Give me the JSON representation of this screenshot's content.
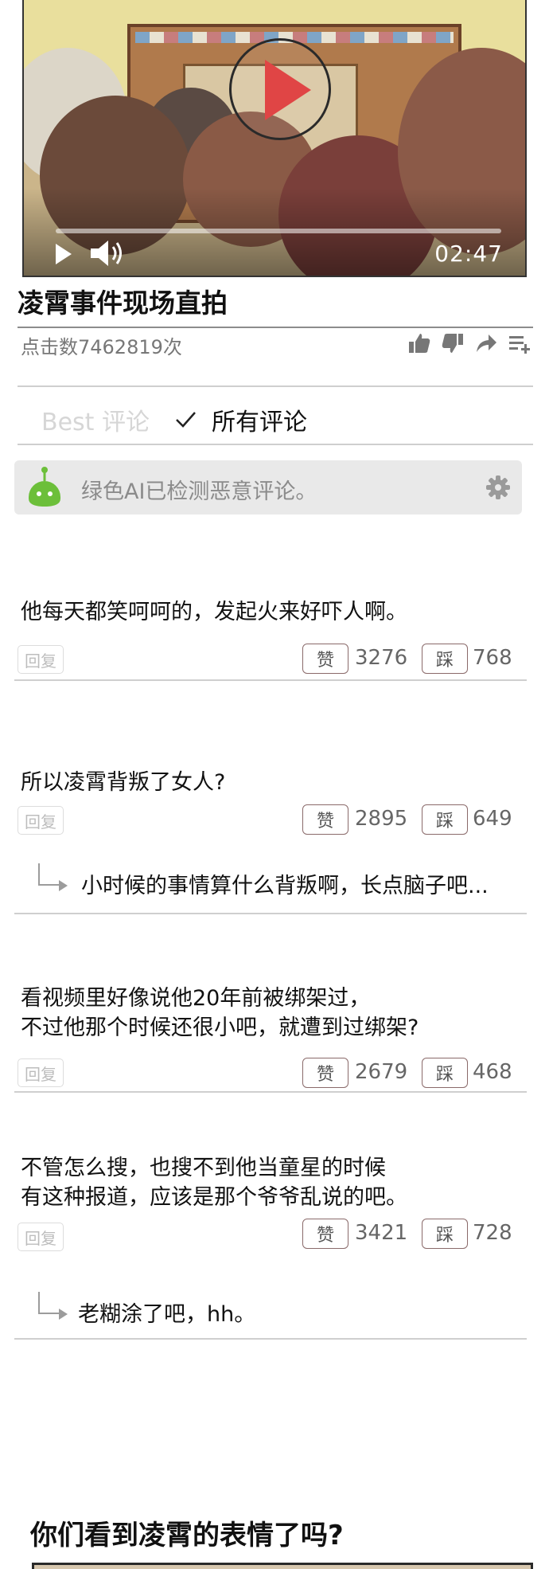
{
  "video": {
    "title": "凌霄事件现场直拍",
    "duration": "02:47",
    "progress": 0.0,
    "views": "点击数7462819次",
    "actions": [
      "thumbs-up-icon",
      "thumbs-down-icon",
      "share-icon",
      "playlist-add-icon"
    ]
  },
  "tabs": {
    "best": "Best 评论",
    "all": "所有评论"
  },
  "ai_notice": {
    "text": "绿色AI已检测恶意评论。",
    "icon_color": "#6cbf3a"
  },
  "reply_label": "回复",
  "like_label": "赞",
  "dislike_label": "踩",
  "comments": [
    {
      "lines": [
        "他每天都笑呵呵的，发起火来好吓人啊。"
      ],
      "likes": "3276",
      "dislikes": "768",
      "reply": null
    },
    {
      "lines": [
        "所以凌霄背叛了女人?"
      ],
      "likes": "2895",
      "dislikes": "649",
      "reply": "小时候的事情算什么背叛啊，长点脑子吧..."
    },
    {
      "lines": [
        "看视频里好像说他20年前被绑架过，",
        "不过他那个时候还很小吧，就遭到过绑架?"
      ],
      "likes": "2679",
      "dislikes": "468",
      "reply": null
    },
    {
      "lines": [
        "不管怎么搜，也搜不到他当童星的时候",
        "有这种报道，应该是那个爷爷乱说的吧。"
      ],
      "likes": "3421",
      "dislikes": "728",
      "reply": "老糊涂了吧，hh。"
    }
  ],
  "caption": "你们看到凌霄的表情了吗?"
}
